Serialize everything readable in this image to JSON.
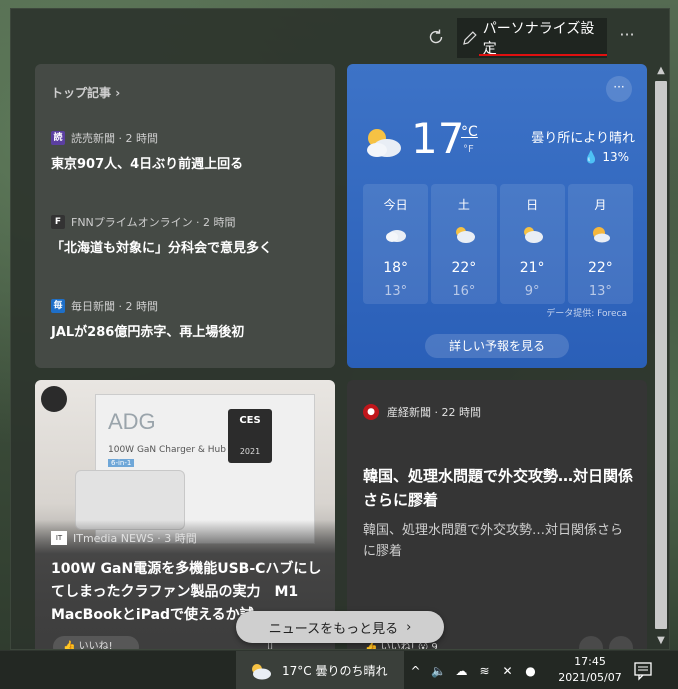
{
  "header": {
    "personalize_label": "パーソナライズ設定",
    "more_label": "···"
  },
  "top_stories": {
    "header": "トップ記事",
    "items": [
      {
        "source": "読売新聞 · 2 時間",
        "icon_text": "読",
        "icon_color": "#5b3fa0",
        "headline": "東京907人、4日ぶり前週上回る"
      },
      {
        "source": "FNNプライムオンライン · 2 時間",
        "icon_text": "F",
        "icon_color": "#333333",
        "headline": "「北海道も対象に」分科会で意見多く"
      },
      {
        "source": "毎日新聞 · 2 時間",
        "icon_text": "毎",
        "icon_color": "#1e6fc8",
        "headline": "JALが286億円赤字、再上場後初"
      }
    ]
  },
  "weather": {
    "more_label": "···",
    "temp": "17",
    "unit_c": "°C",
    "unit_f": "°F",
    "condition": "曇り所により晴れ",
    "precip": "13%",
    "forecast": [
      {
        "day": "今日",
        "hi": "18°",
        "lo": "13°",
        "icon": "cloudy-icon"
      },
      {
        "day": "土",
        "hi": "22°",
        "lo": "16°",
        "icon": "partly-cloudy-icon"
      },
      {
        "day": "日",
        "hi": "21°",
        "lo": "9°",
        "icon": "partly-cloudy-icon"
      },
      {
        "day": "月",
        "hi": "22°",
        "lo": "13°",
        "icon": "sun-cloud-icon"
      }
    ],
    "credit": "データ提供: Foreca",
    "detail_button": "詳しい予報を見る"
  },
  "article_a": {
    "source": "ITmedia NEWS · 3 時間",
    "title": "100W GaN電源を多機能USB-Cハブにしてしまったクラファン製品の実力　M1 MacBookとiPadで使えるか試",
    "box_brand": "ADG",
    "box_line": "100W GaN Charger & Hub",
    "box_sub": "6-in-1",
    "ces_label": "CES",
    "ces_year": "2021",
    "like_label": "👍 いいね!"
  },
  "article_b": {
    "source": "産経新聞 · 22 時間",
    "title": "韓国、処理水問題で外交攻勢…対日関係さらに膠着",
    "desc": "韓国、処理水問題で外交攻勢…対日関係さらに膠着",
    "like_label": "👍 いいね!  😮 9"
  },
  "more_news": {
    "label": "ニュースをもっと見る",
    "arrow": "›"
  },
  "taskbar": {
    "weather_text": "17°C  曇りのち晴れ",
    "time": "17:45",
    "date": "2021/05/07"
  }
}
